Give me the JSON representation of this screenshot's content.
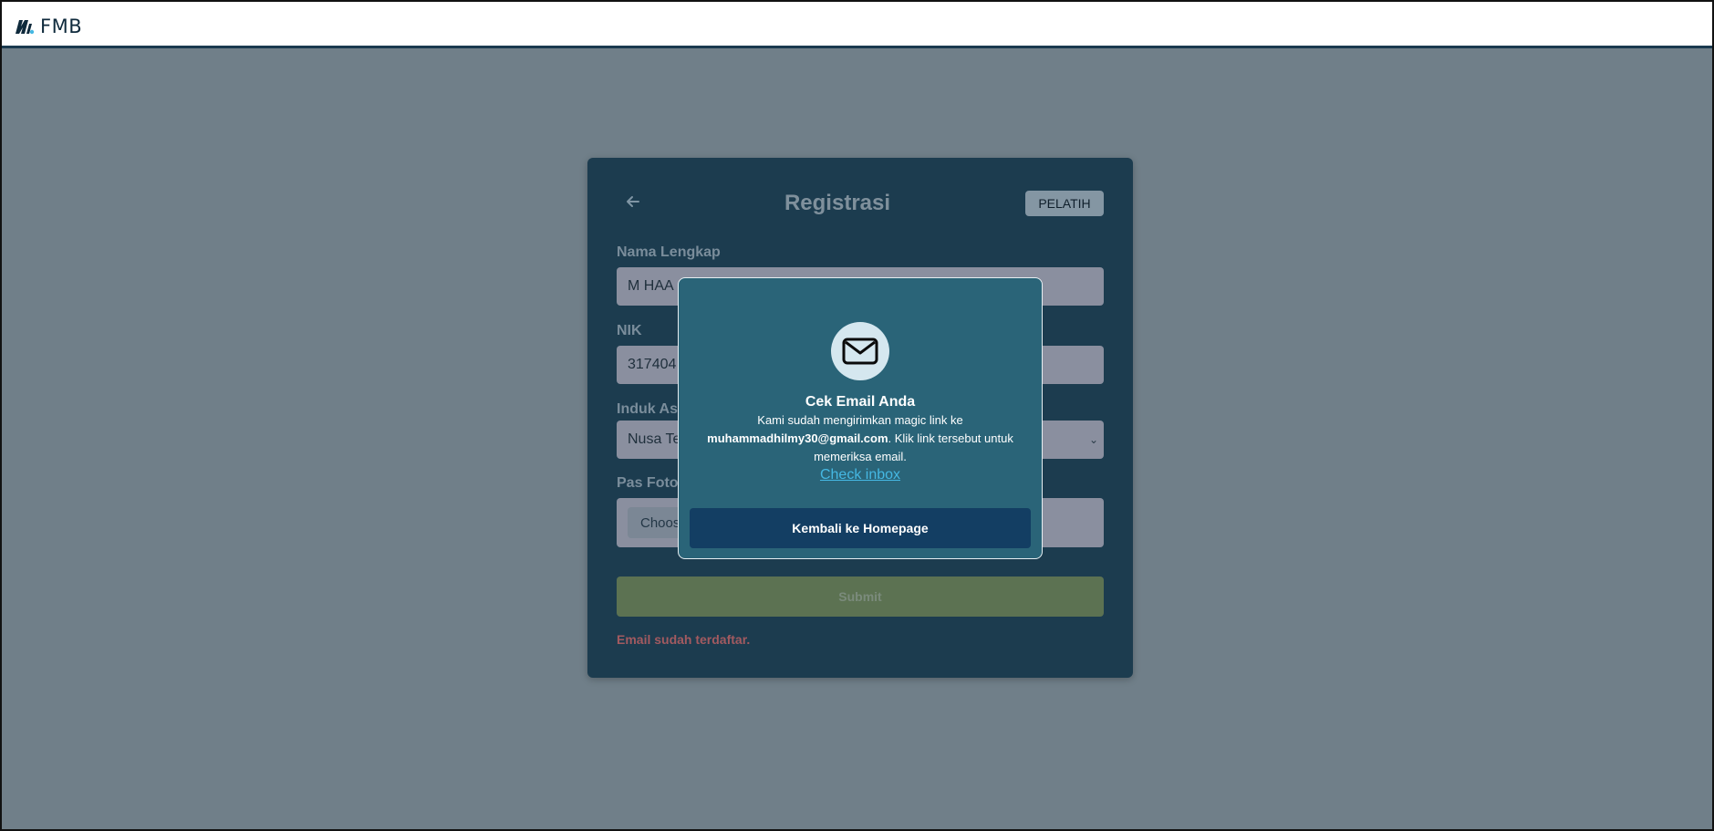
{
  "app": {
    "brand_name": "FMB",
    "logo_icon": "fmb-logo-icon"
  },
  "form": {
    "title": "Registrasi",
    "role_badge": "PELATIH",
    "back_icon": "arrow-left-icon",
    "fields": {
      "full_name": {
        "label": "Nama Lengkap",
        "value": "M HAA"
      },
      "nik": {
        "label": "NIK",
        "value": "317404"
      },
      "association": {
        "label": "Induk Aso",
        "value": "Nusa Te"
      },
      "photo": {
        "label": "Pas Foto",
        "button_label": "Choos"
      }
    },
    "submit_label": "Submit",
    "error_message": "Email sudah terdaftar."
  },
  "modal": {
    "icon": "mail-icon",
    "title": "Cek Email Anda",
    "message_prefix": "Kami sudah mengirimkan magic link ke",
    "email": "muhammadhilmy30@gmail.com",
    "message_suffix": ". Klik link tersebut untuk memeriksa email.",
    "link_label": "Check inbox",
    "button_label": "Kembali ke Homepage"
  },
  "colors": {
    "overlay": "#707f89",
    "card": "#1c3c4f",
    "modal": "#2a6478",
    "modal_button": "#133e63",
    "submit_button": "#5c7252",
    "error": "#a25a60",
    "link": "#45b8e3"
  }
}
